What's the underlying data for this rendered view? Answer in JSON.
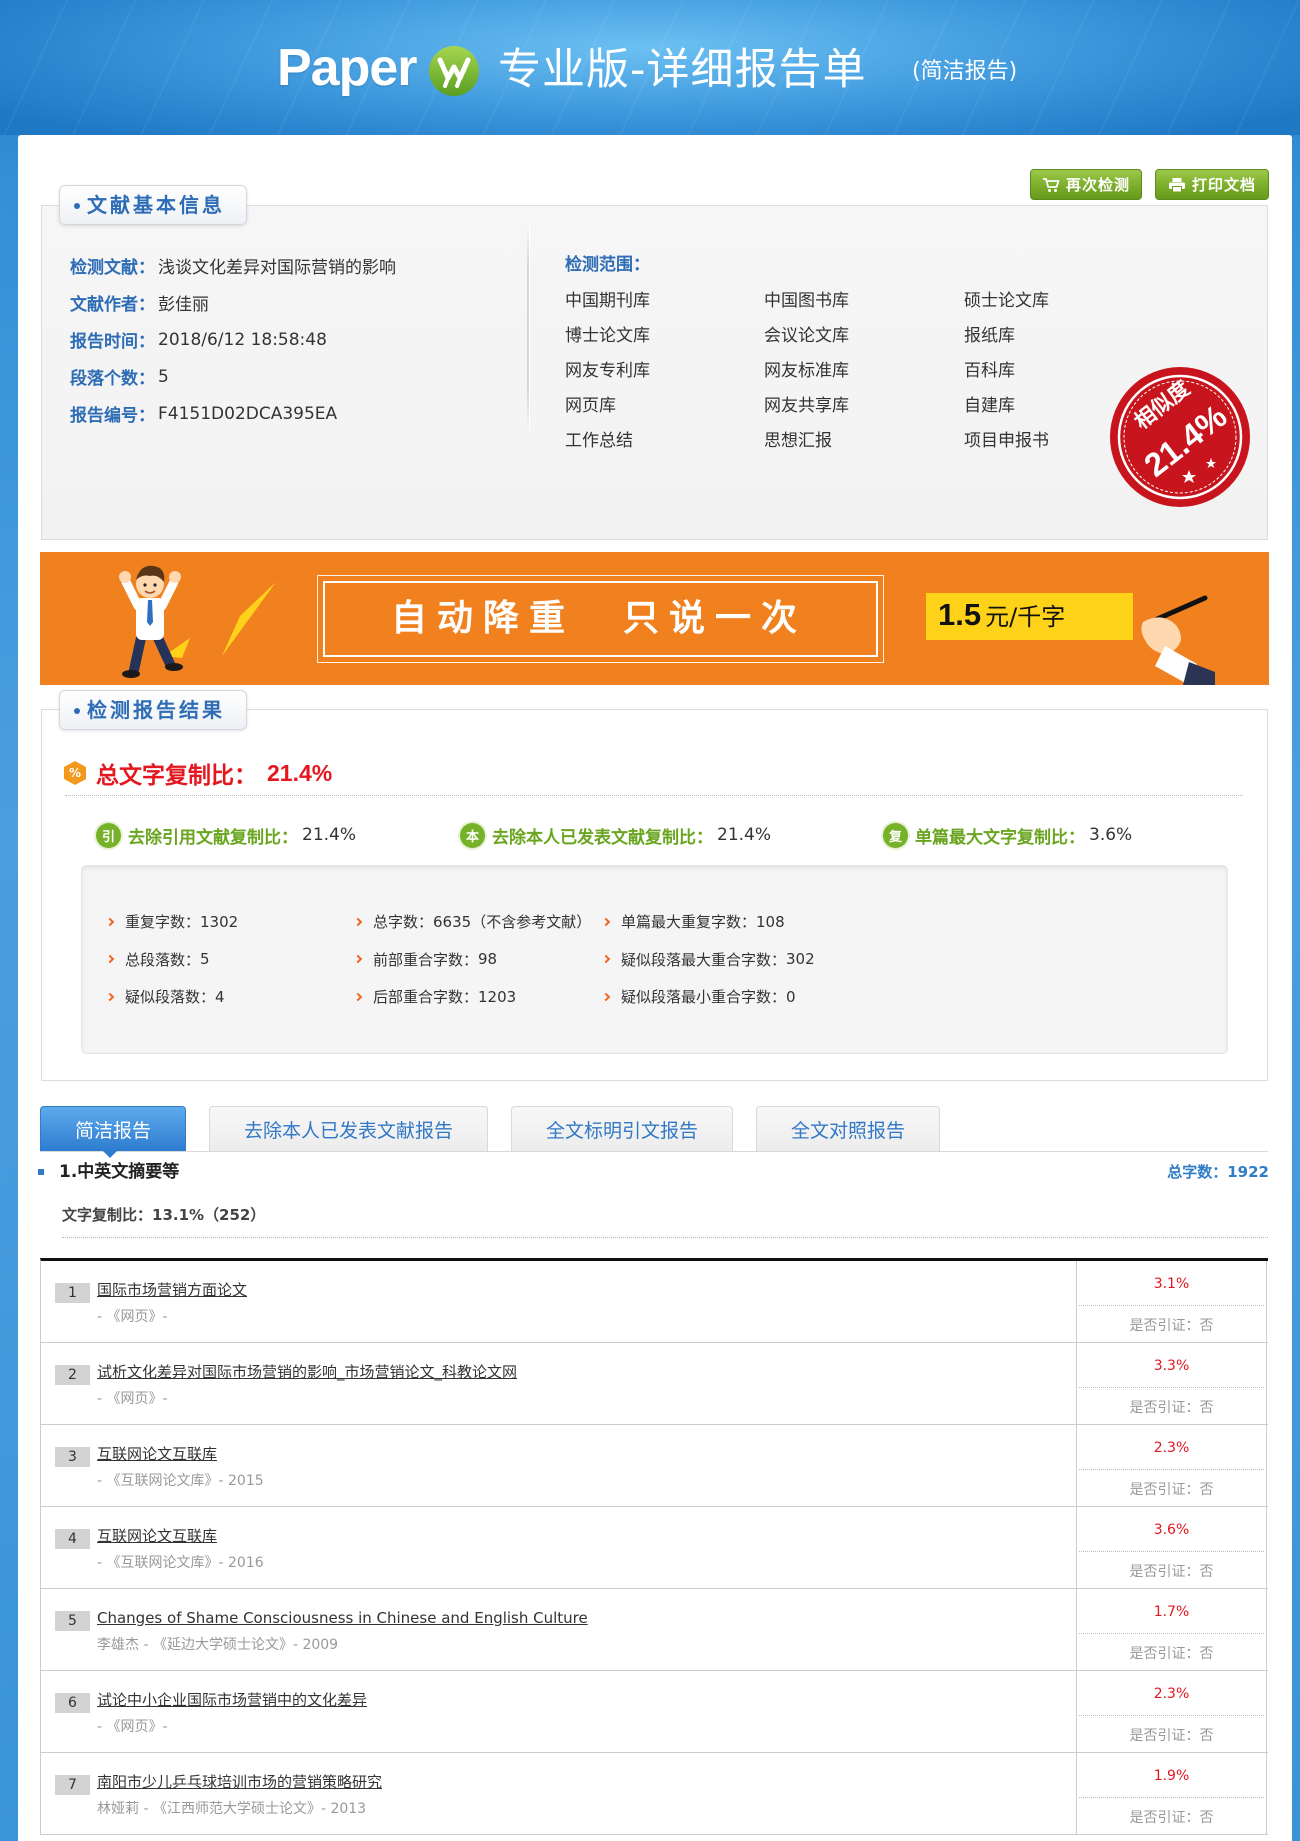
{
  "header": {
    "logo_text": "Paper",
    "title": "专业版-详细报告单",
    "subtitle": "(简洁报告)"
  },
  "toolbar": {
    "recheck_label": "再次检测",
    "print_label": "打印文档",
    "recheck_icon": "cart-icon",
    "print_icon": "printer-icon"
  },
  "basic_info": {
    "section_title": "文献基本信息",
    "fields": [
      {
        "label": "检测文献：",
        "value": "浅谈文化差异对国际营销的影响"
      },
      {
        "label": "文献作者：",
        "value": "彭佳丽"
      },
      {
        "label": "报告时间：",
        "value": "2018/6/12 18:58:48"
      },
      {
        "label": "段落个数：",
        "value": "5"
      },
      {
        "label": "报告编号：",
        "value": "F4151D02DCA395EA"
      }
    ],
    "scope_label": "检测范围：",
    "databases": [
      "中国期刊库",
      "中国图书库",
      "硕士论文库",
      "博士论文库",
      "会议论文库",
      "报纸库",
      "网友专利库",
      "网友标准库",
      "百科库",
      "网页库",
      "网友共享库",
      "自建库",
      "工作总结",
      "思想汇报",
      "项目申报书"
    ]
  },
  "stamp": {
    "label": "相似度",
    "value": "21.4%"
  },
  "promo_banner": {
    "slogan_1": "自动降重",
    "slogan_2": "只说一次",
    "price": "1.5",
    "price_unit": "元/千字"
  },
  "results": {
    "section_title": "检测报告结果",
    "total_icon": "%",
    "total_label": "总文字复制比：",
    "total_value": "21.4%",
    "metrics": [
      {
        "icon": "引",
        "label": "去除引用文献复制比：",
        "value": "21.4%"
      },
      {
        "icon": "本",
        "label": "去除本人已发表文献复制比：",
        "value": "21.4%"
      },
      {
        "icon": "复",
        "label": "单篇最大文字复制比：",
        "value": "3.6%"
      }
    ],
    "stats": [
      [
        {
          "label": "重复字数：",
          "value": "1302"
        },
        {
          "label": "总段落数：",
          "value": "5"
        },
        {
          "label": "疑似段落数：",
          "value": "4"
        }
      ],
      [
        {
          "label": "总字数：",
          "value": "6635",
          "note": "（不含参考文献）"
        },
        {
          "label": "前部重合字数：",
          "value": "98"
        },
        {
          "label": "后部重合字数：",
          "value": "1203"
        }
      ],
      [
        {
          "label": "单篇最大重复字数：",
          "value": "108"
        },
        {
          "label": "疑似段落最大重合字数：",
          "value": "302"
        },
        {
          "label": "疑似段落最小重合字数：",
          "value": "0"
        }
      ]
    ]
  },
  "tabs": [
    {
      "label": "简洁报告",
      "active": true
    },
    {
      "label": "去除本人已发表文献报告",
      "active": false
    },
    {
      "label": "全文标明引文报告",
      "active": false
    },
    {
      "label": "全文对照报告",
      "active": false
    }
  ],
  "section": {
    "title": "1.中英文摘要等",
    "total_words_label": "总字数：",
    "total_words": "1922",
    "copy_ratio_label": "文字复制比：",
    "copy_ratio": "13.1%（252）"
  },
  "matches": [
    {
      "index": "1",
      "title": "国际市场营销方面论文",
      "source": "- 《网页》-",
      "ratio": "3.1%",
      "citation": "是否引证：否"
    },
    {
      "index": "2",
      "title": "试析文化差异对国际市场营销的影响_市场营销论文_科教论文网",
      "source": "- 《网页》-",
      "ratio": "3.3%",
      "citation": "是否引证：否"
    },
    {
      "index": "3",
      "title": "互联网论文互联库",
      "source": "- 《互联网论文库》- 2015",
      "ratio": "2.3%",
      "citation": "是否引证：否"
    },
    {
      "index": "4",
      "title": "互联网论文互联库",
      "source": "- 《互联网论文库》- 2016",
      "ratio": "3.6%",
      "citation": "是否引证：否"
    },
    {
      "index": "5",
      "title": "Changes of Shame Consciousness in Chinese and English Culture",
      "source": "李雄杰 - 《延边大学硕士论文》- 2009",
      "ratio": "1.7%",
      "citation": "是否引证：否"
    },
    {
      "index": "6",
      "title": "试论中小企业国际市场营销中的文化差异",
      "source": "- 《网页》-",
      "ratio": "2.3%",
      "citation": "是否引证：否"
    },
    {
      "index": "7",
      "title": "南阳市少儿乒乓球培训市场的营销策略研究",
      "source": "林娅莉 - 《江西师范大学硕士论文》- 2013",
      "ratio": "1.9%",
      "citation": "是否引证：否"
    }
  ],
  "colors": {
    "brand_blue": "#2e6db5",
    "alert_red": "#e4171f",
    "metric_green": "#6aa520",
    "promo_orange": "#f0811e",
    "button_green": "#7cad2c"
  }
}
